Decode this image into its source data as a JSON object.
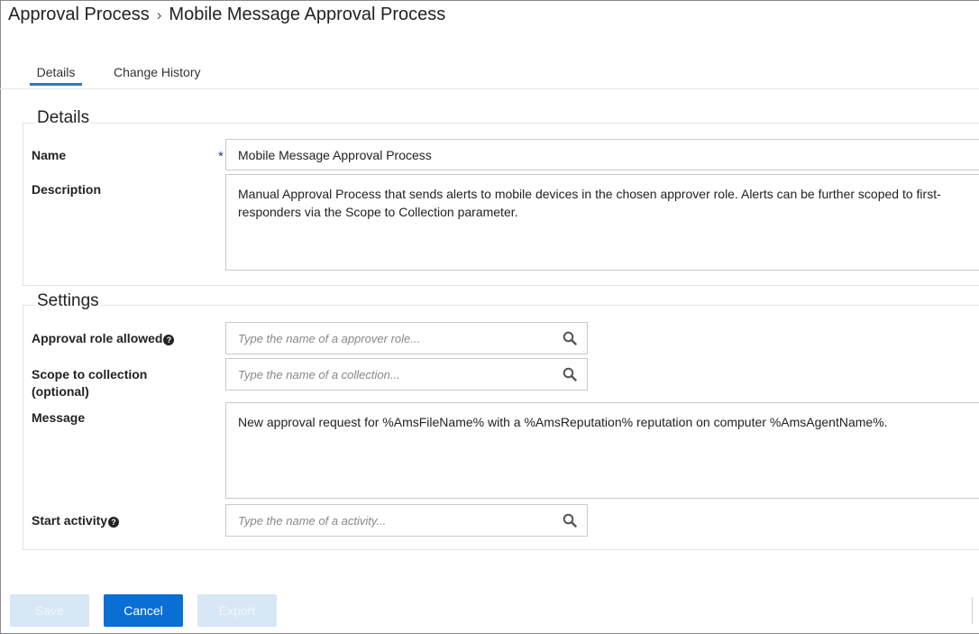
{
  "breadcrumb": {
    "parent": "Approval Process",
    "separator": "›",
    "current": "Mobile Message Approval Process"
  },
  "tabs": [
    {
      "label": "Details",
      "active": true
    },
    {
      "label": "Change History",
      "active": false
    }
  ],
  "details_section": {
    "title": "Details",
    "name_label": "Name",
    "required_mark": "*",
    "name_value": "Mobile Message Approval Process",
    "description_label": "Description",
    "description_value": "Manual Approval Process that sends alerts to mobile devices in the chosen approver role. Alerts can be further scoped to first-responders via the Scope to Collection parameter."
  },
  "settings_section": {
    "title": "Settings",
    "approval_role_label": "Approval role allowed",
    "approval_role_placeholder": "Type the name of a approver role...",
    "scope_label_line1": "Scope to collection",
    "scope_label_line2": "(optional)",
    "scope_placeholder": "Type the name of a collection...",
    "message_label": "Message",
    "message_value": "New approval request for %AmsFileName% with a %AmsReputation% reputation on computer %AmsAgentName%.",
    "start_activity_label": "Start activity",
    "start_activity_placeholder": "Type the name of a activity..."
  },
  "help_glyph": "?",
  "icons": {
    "search": "search-icon",
    "help": "question-circle-icon"
  },
  "buttons": {
    "save": "Save",
    "cancel": "Cancel",
    "export": "Export"
  },
  "colors": {
    "primary": "#0a6fd2",
    "disabled": "#d8e7f5",
    "tab_underline": "#1a7fd6"
  }
}
